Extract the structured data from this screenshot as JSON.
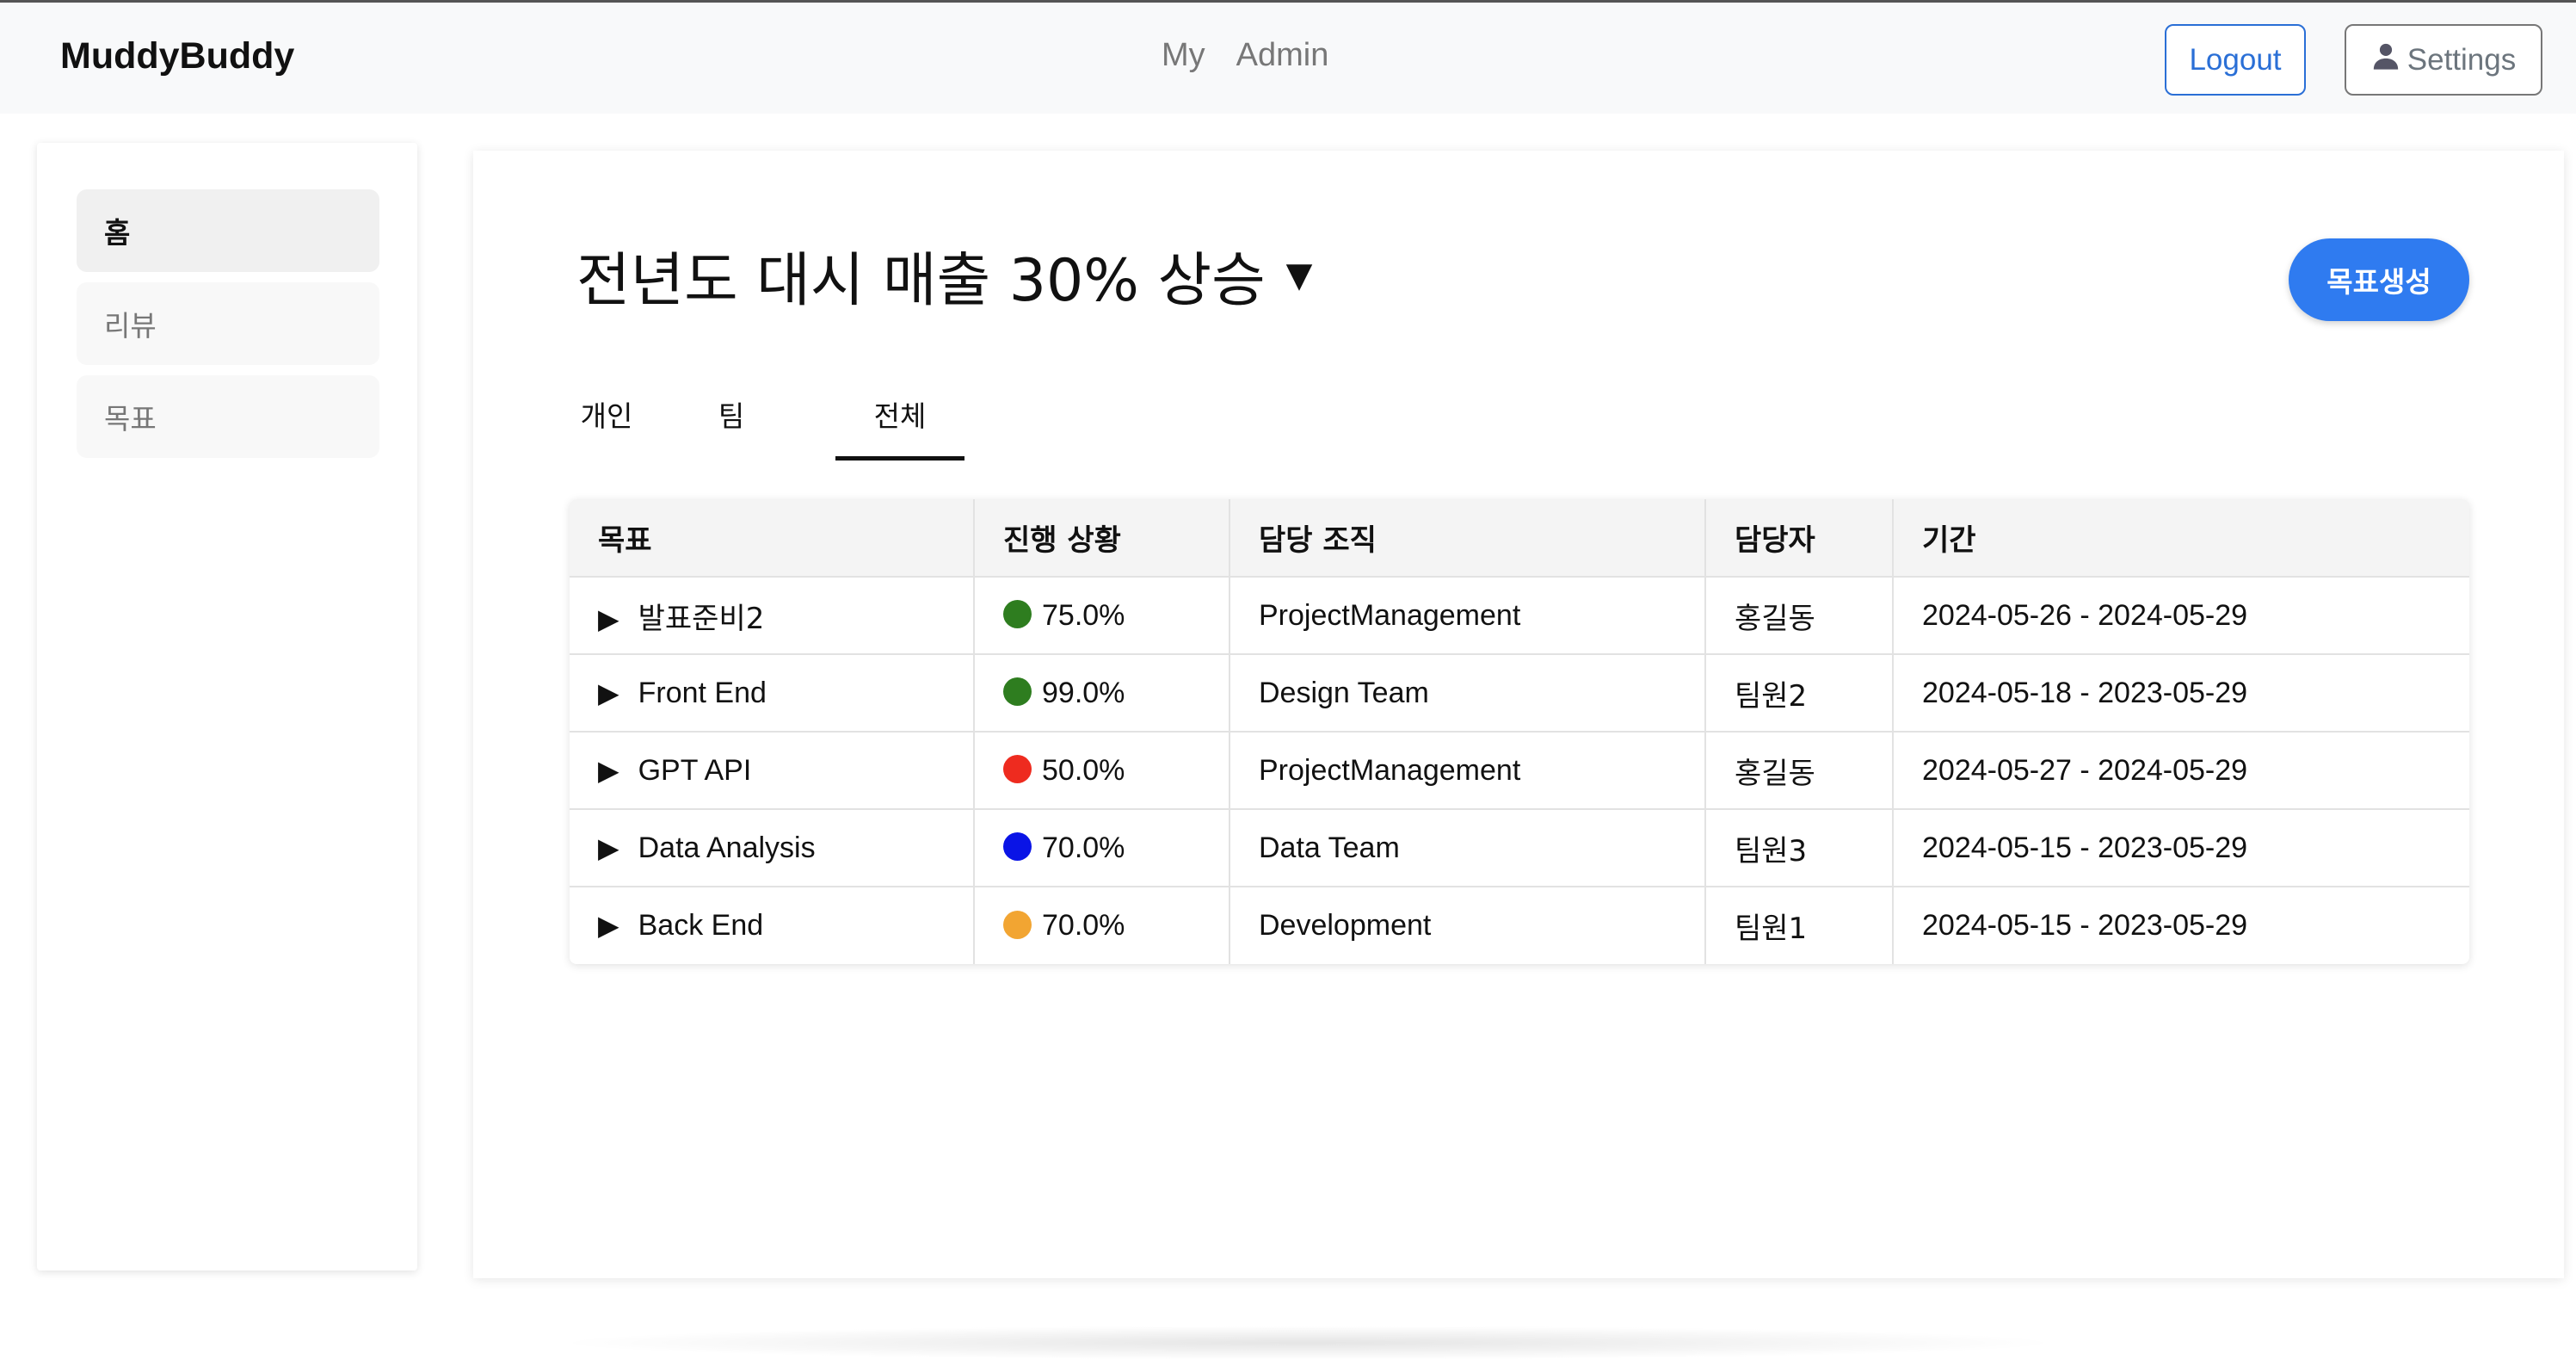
{
  "app": {
    "brand": "MuddyBuddy"
  },
  "topnav": {
    "items": [
      "My",
      "Admin"
    ]
  },
  "header_buttons": {
    "logout": "Logout",
    "settings": "Settings"
  },
  "sidebar": {
    "items": [
      {
        "label": "홈",
        "active": true
      },
      {
        "label": "리뷰",
        "active": false
      },
      {
        "label": "목표",
        "active": false
      }
    ]
  },
  "main": {
    "title": "전년도 대시 매출 30% 상승",
    "create_button": "목표생성",
    "tabs": [
      {
        "label": "개인"
      },
      {
        "label": "팀"
      },
      {
        "label": "전체",
        "active": true
      }
    ]
  },
  "table": {
    "headers": [
      "목표",
      "진행 상황",
      "담당 조직",
      "담당자",
      "기간"
    ],
    "rows": [
      {
        "goal": "발표준비2",
        "progress": "75.0%",
        "status_color": "#2e7d1f",
        "org": "ProjectManagement",
        "owner": "홍길동",
        "period": "2024-05-26 - 2024-05-29"
      },
      {
        "goal": "Front End",
        "progress": "99.0%",
        "status_color": "#2e7d1f",
        "org": "Design Team",
        "owner": "팀원2",
        "period": "2024-05-18 - 2023-05-29"
      },
      {
        "goal": "GPT API",
        "progress": "50.0%",
        "status_color": "#ee2b1f",
        "org": "ProjectManagement",
        "owner": "홍길동",
        "period": "2024-05-27 - 2024-05-29"
      },
      {
        "goal": "Data Analysis",
        "progress": "70.0%",
        "status_color": "#0a14e6",
        "org": "Data Team",
        "owner": "팀원3",
        "period": "2024-05-15 - 2023-05-29"
      },
      {
        "goal": "Back End",
        "progress": "70.0%",
        "status_color": "#f2a532",
        "org": "Development",
        "owner": "팀원1",
        "period": "2024-05-15 - 2023-05-29"
      }
    ]
  },
  "colors": {
    "accent": "#2f7bf0",
    "logout": "#2a6fd6",
    "topbar_bg": "#f8f9fa"
  }
}
